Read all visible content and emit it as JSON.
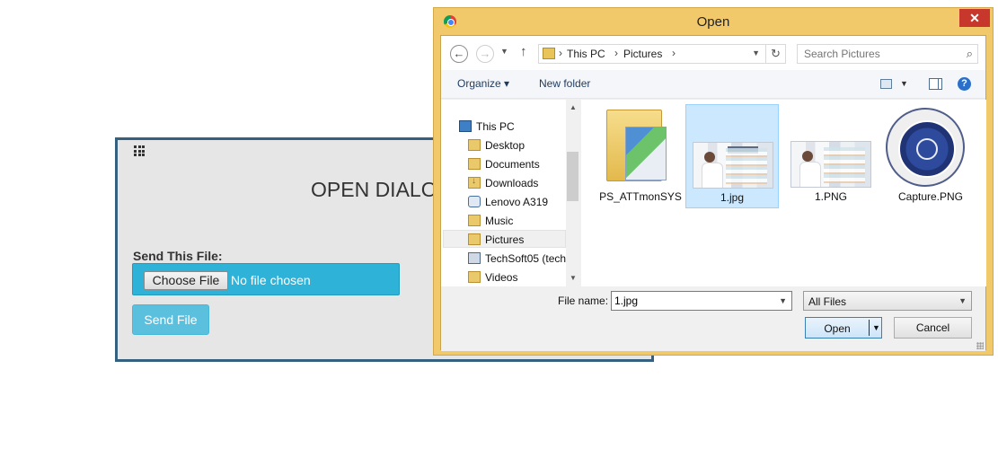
{
  "page": {
    "title": "OPEN DIALO",
    "field_label": "Send This File:",
    "choose_file_label": "Choose File",
    "no_file_text": "No file chosen",
    "send_label": "Send File"
  },
  "dialog": {
    "title": "Open",
    "close_glyph": "✕",
    "breadcrumb": [
      "This PC",
      "Pictures"
    ],
    "search_placeholder": "Search Pictures",
    "toolbar": {
      "organize_label": "Organize ▾",
      "new_folder_label": "New folder",
      "help_glyph": "?"
    },
    "nav_items": [
      {
        "label": "This PC",
        "icon": "computer-icon"
      },
      {
        "label": "Desktop",
        "icon": "folder-icon"
      },
      {
        "label": "Documents",
        "icon": "folder-icon"
      },
      {
        "label": "Downloads",
        "icon": "downloads-icon"
      },
      {
        "label": "Lenovo A319",
        "icon": "phone-icon"
      },
      {
        "label": "Music",
        "icon": "folder-icon"
      },
      {
        "label": "Pictures",
        "icon": "folder-icon",
        "selected": true
      },
      {
        "label": "TechSoft05 (tech",
        "icon": "network-icon"
      },
      {
        "label": "Videos",
        "icon": "folder-icon"
      }
    ],
    "files": [
      {
        "name": "PS_ATTmonSYS",
        "kind": "folder"
      },
      {
        "name": "1.jpg",
        "kind": "image",
        "selected": true
      },
      {
        "name": "1.PNG",
        "kind": "image"
      },
      {
        "name": "Capture.PNG",
        "kind": "seal-image"
      }
    ],
    "file_name_label": "File name:",
    "file_name_value": "1.jpg",
    "filter_value": "All Files",
    "open_label": "Open",
    "cancel_label": "Cancel"
  },
  "colors": {
    "dialog_frame": "#f2c96a",
    "file_box": "#2eb2d8",
    "send_button": "#5bc0de",
    "panel_border": "#35607f",
    "selection": "#cce8ff"
  }
}
